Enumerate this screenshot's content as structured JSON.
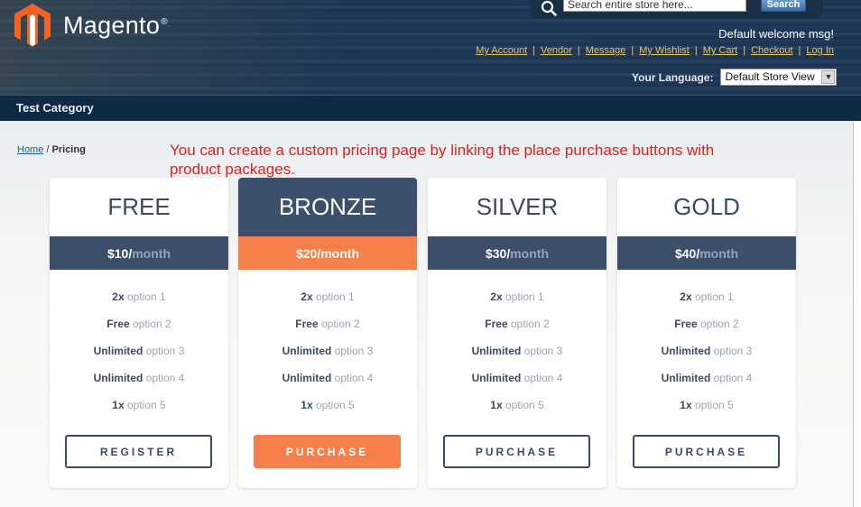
{
  "header": {
    "logo_text": "Magento",
    "logo_reg": "®",
    "search_placeholder": "Search entire store here...",
    "search_button": "Search",
    "welcome": "Default welcome msg!",
    "links": [
      "My Account",
      "Vendor",
      "Message",
      "My Wishlist",
      "My Cart",
      "Checkout",
      "Log In"
    ],
    "language_label": "Your Language:",
    "language_value": "Default Store View"
  },
  "nav": {
    "item": "Test Category"
  },
  "breadcrumb": {
    "home": "Home",
    "separator": " / ",
    "current": "Pricing"
  },
  "notice": "You can create a custom pricing page by linking the place purchase buttons with product packages.",
  "plans": [
    {
      "name": "FREE",
      "price": "$10/",
      "period": "month",
      "button": "REGISTER",
      "active": false,
      "options": [
        {
          "qty": "2x",
          "label": "option 1"
        },
        {
          "qty": "Free",
          "label": "option 2"
        },
        {
          "qty": "Unlimited",
          "label": "option 3"
        },
        {
          "qty": "Unlimited",
          "label": "option 4"
        },
        {
          "qty": "1x",
          "label": "option 5"
        }
      ]
    },
    {
      "name": "BRONZE",
      "price": "$20/",
      "period": "month",
      "button": "PURCHASE",
      "active": true,
      "options": [
        {
          "qty": "2x",
          "label": "option 1"
        },
        {
          "qty": "Free",
          "label": "option 2"
        },
        {
          "qty": "Unlimited",
          "label": "option 3"
        },
        {
          "qty": "Unlimited",
          "label": "option 4"
        },
        {
          "qty": "1x",
          "label": "option 5"
        }
      ]
    },
    {
      "name": "SILVER",
      "price": "$30/",
      "period": "month",
      "button": "PURCHASE",
      "active": false,
      "options": [
        {
          "qty": "2x",
          "label": "option 1"
        },
        {
          "qty": "Free",
          "label": "option 2"
        },
        {
          "qty": "Unlimited",
          "label": "option 3"
        },
        {
          "qty": "Unlimited",
          "label": "option 4"
        },
        {
          "qty": "1x",
          "label": "option 5"
        }
      ]
    },
    {
      "name": "GOLD",
      "price": "$40/",
      "period": "month",
      "button": "PURCHASE",
      "active": false,
      "options": [
        {
          "qty": "2x",
          "label": "option 1"
        },
        {
          "qty": "Free",
          "label": "option 2"
        },
        {
          "qty": "Unlimited",
          "label": "option 3"
        },
        {
          "qty": "Unlimited",
          "label": "option 4"
        },
        {
          "qty": "1x",
          "label": "option 5"
        }
      ]
    }
  ],
  "colors": {
    "accent_orange": "#f5804b",
    "slate": "#3d4e6b",
    "notice_red": "#e0201c",
    "link_gold": "#e8c46a"
  }
}
